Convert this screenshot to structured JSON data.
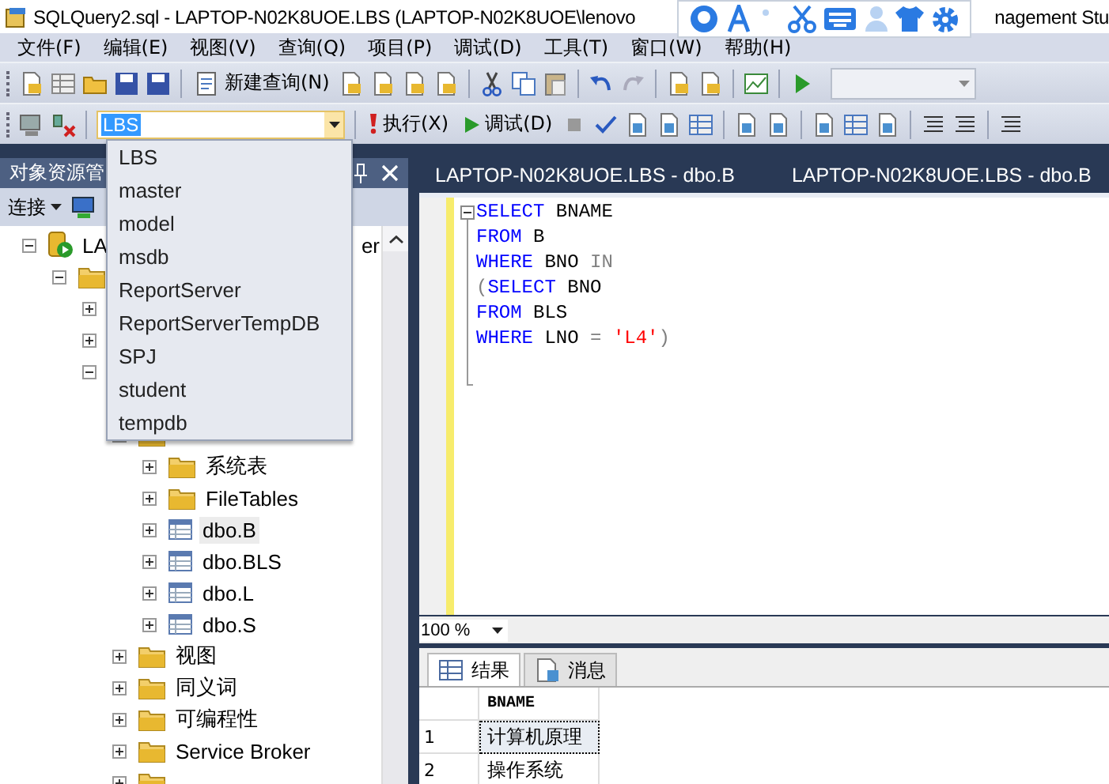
{
  "window": {
    "title_start": "SQLQuery2.sql - LAPTOP-N02K8UOE.LBS (LAPTOP-N02K8UOE\\lenovo",
    "title_end": "nagement Stu"
  },
  "menu": [
    "文件(F)",
    "编辑(E)",
    "视图(V)",
    "查询(Q)",
    "项目(P)",
    "调试(D)",
    "工具(T)",
    "窗口(W)",
    "帮助(H)"
  ],
  "toolbar": {
    "new_query": "新建查询(N)",
    "database": "LBS",
    "execute": "执行(X)",
    "debug": "调试(D)"
  },
  "database_dropdown": [
    "LBS",
    "master",
    "model",
    "msdb",
    "ReportServer",
    "ReportServerTempDB",
    "SPJ",
    "student",
    "tempdb"
  ],
  "object_explorer": {
    "title": "对象资源管",
    "connect": "连接",
    "tree": [
      {
        "kind": "server",
        "label_start": "LA",
        "label_end": "er",
        "expanded": true,
        "children": [
          {
            "kind": "folder",
            "expanded": true,
            "children": [
              {
                "expanded": false
              },
              {
                "expanded": false
              },
              {
                "expanded": true,
                "children": [
                  {
                    "kind": "covered"
                  },
                  {
                    "kind": "folder",
                    "expanded": true,
                    "children": [
                      {
                        "kind": "folder",
                        "label": "系统表",
                        "expanded": false,
                        "selected": false
                      },
                      {
                        "kind": "folder",
                        "label": "FileTables",
                        "expanded": false,
                        "selected": false
                      },
                      {
                        "kind": "table",
                        "label": "dbo.B",
                        "expanded": false,
                        "selected": true
                      },
                      {
                        "kind": "table",
                        "label": "dbo.BLS",
                        "expanded": false,
                        "selected": false
                      },
                      {
                        "kind": "table",
                        "label": "dbo.L",
                        "expanded": false,
                        "selected": false
                      },
                      {
                        "kind": "table",
                        "label": "dbo.S",
                        "expanded": false,
                        "selected": false
                      }
                    ]
                  },
                  {
                    "kind": "folder",
                    "label": "视图",
                    "expanded": false,
                    "selected": false
                  },
                  {
                    "kind": "folder",
                    "label": "同义词",
                    "expanded": false,
                    "selected": false
                  },
                  {
                    "kind": "folder",
                    "label": "可编程性",
                    "expanded": false,
                    "selected": false
                  },
                  {
                    "kind": "folder",
                    "label": "Service Broker",
                    "expanded": false,
                    "selected": false
                  },
                  {
                    "kind": "folder",
                    "expanded": false
                  }
                ]
              }
            ]
          }
        ]
      }
    ]
  },
  "editor_tabs": [
    {
      "label": "LAPTOP-N02K8UOE.LBS - dbo.B"
    },
    {
      "label": "LAPTOP-N02K8UOE.LBS - dbo.B"
    }
  ],
  "code": [
    [
      {
        "kind": "keyword",
        "text": "SELECT"
      },
      {
        "kind": "plain",
        "text": " BNAME"
      }
    ],
    [
      {
        "kind": "keyword",
        "text": "FROM"
      },
      {
        "kind": "plain",
        "text": " B"
      }
    ],
    [
      {
        "kind": "keyword",
        "text": "WHERE"
      },
      {
        "kind": "plain",
        "text": " BNO "
      },
      {
        "kind": "operator",
        "text": "IN"
      }
    ],
    [
      {
        "kind": "operator",
        "text": "("
      },
      {
        "kind": "keyword",
        "text": "SELECT"
      },
      {
        "kind": "plain",
        "text": " BNO"
      }
    ],
    [
      {
        "kind": "keyword",
        "text": "FROM"
      },
      {
        "kind": "plain",
        "text": " BLS"
      }
    ],
    [
      {
        "kind": "keyword",
        "text": "WHERE"
      },
      {
        "kind": "plain",
        "text": " LNO "
      },
      {
        "kind": "operator",
        "text": "= "
      },
      {
        "kind": "string",
        "text": "'L4'"
      },
      {
        "kind": "operator",
        "text": ")"
      }
    ]
  ],
  "zoom": "100 %",
  "result_tabs": [
    {
      "label": "结果",
      "selected": true
    },
    {
      "label": "消息",
      "selected": false
    }
  ],
  "results": {
    "columns": [
      "BNAME"
    ],
    "rows": [
      {
        "number": "1",
        "cells": [
          "计算机原理"
        ],
        "selected": true
      },
      {
        "number": "2",
        "cells": [
          "操作系统"
        ],
        "selected": false
      }
    ]
  }
}
